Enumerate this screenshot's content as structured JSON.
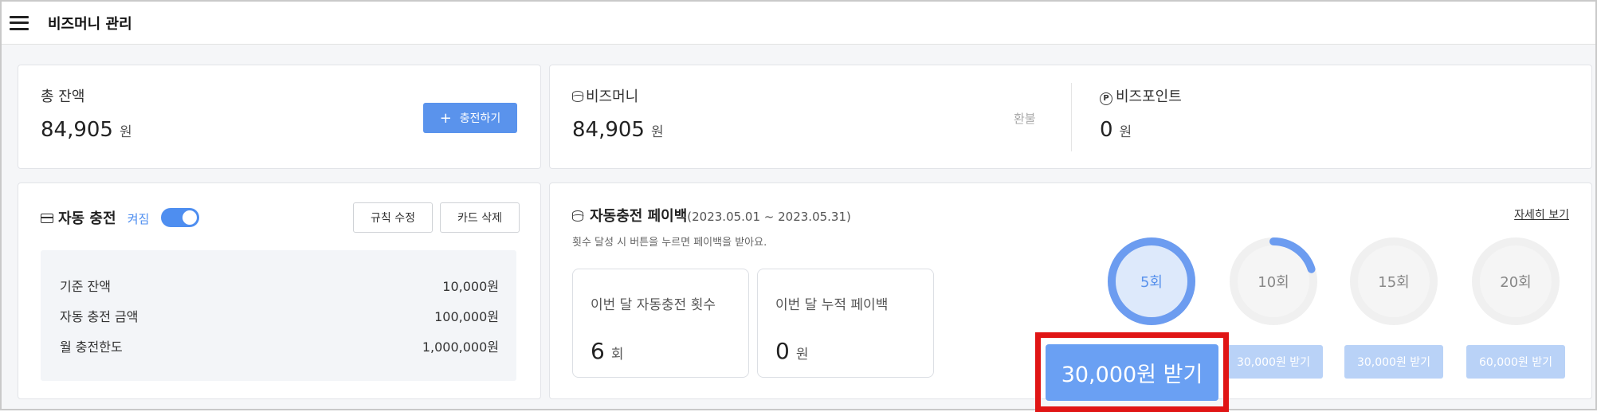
{
  "header": {
    "title": "비즈머니 관리"
  },
  "total": {
    "label": "총 잔액",
    "amount": "84,905",
    "unit": "원",
    "charge_button": "충전하기",
    "charge_icon": "+"
  },
  "bizmoney": {
    "label": "비즈머니",
    "amount": "84,905",
    "unit": "원",
    "refund": "환불"
  },
  "bizpoint": {
    "label": "비즈포인트",
    "icon_letter": "P",
    "amount": "0",
    "unit": "원"
  },
  "auto_charge": {
    "title": "자동 충전",
    "status": "켜짐",
    "toggle_on": true,
    "edit_rule": "규칙 수정",
    "delete_card": "카드 삭제",
    "rules": [
      {
        "label": "기준 잔액",
        "value": "10,000원"
      },
      {
        "label": "자동 충전 금액",
        "value": "100,000원"
      },
      {
        "label": "월 충전한도",
        "value": "1,000,000원"
      }
    ]
  },
  "payback": {
    "title": "자동충전 페이백",
    "period": "(2023.05.01 ~ 2023.05.31)",
    "description": "횟수 달성 시 버튼을 누르면 페이백을 받아요.",
    "details_link": "자세히 보기",
    "count_label": "이번 달 자동충전 횟수",
    "count_value": "6",
    "count_unit": "회",
    "accum_label": "이번 달 누적 페이백",
    "accum_value": "0",
    "accum_unit": "원",
    "milestones": [
      {
        "label": "5회",
        "progress": 1.0,
        "reward": "30,000원 받기",
        "active": true
      },
      {
        "label": "10회",
        "progress": 0.2,
        "reward": "30,000원 받기",
        "active": false
      },
      {
        "label": "15회",
        "progress": 0.0,
        "reward": "30,000원 받기",
        "active": false
      },
      {
        "label": "20회",
        "progress": 0.0,
        "reward": "60,000원 받기",
        "active": false
      }
    ]
  },
  "colors": {
    "accent": "#5a93ec",
    "ring_track": "#f0f0f0",
    "ring_progress": "#6c9cf0",
    "highlight": "#e01515"
  }
}
